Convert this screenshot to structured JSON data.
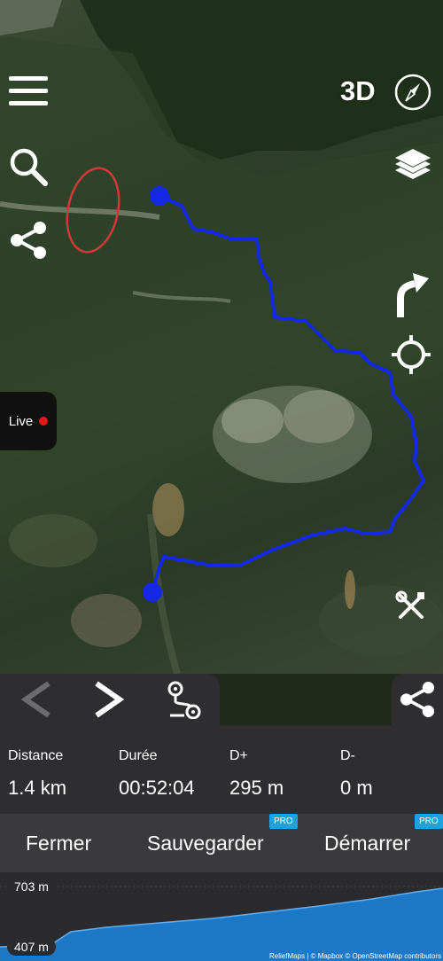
{
  "map": {
    "btn_3d": "3D",
    "live_label": "Live",
    "attribution": "ReliefMaps | © Mapbox © OpenStreetMap contributors",
    "track_color": "#1428e6",
    "live_dot_color": "#e01919",
    "annotation_color": "#d23a3a",
    "icons": [
      "menu-icon",
      "search-icon",
      "share-icon",
      "compass-icon",
      "layers-icon",
      "turn-arrow-icon",
      "locate-icon",
      "tools-icon"
    ]
  },
  "nav": {
    "prev_icon": "chevron-left-icon",
    "next_icon": "chevron-right-icon",
    "route_icon": "route-icon",
    "share_icon": "share-icon"
  },
  "stats": [
    {
      "label": "Distance",
      "value": "1.4 km"
    },
    {
      "label": "Durée",
      "value": "00:52:04"
    },
    {
      "label": "D+",
      "value": "295 m"
    },
    {
      "label": "D-",
      "value": "0 m"
    }
  ],
  "actions": {
    "close": "Fermer",
    "save": "Sauvegarder",
    "start": "Démarrer",
    "pro_badge": "PRO",
    "pro_badge_color": "#1aa3e0"
  },
  "profile": {
    "max_label": "703 m",
    "min_label": "407 m",
    "max_m": 703,
    "min_m": 407,
    "fill_color": "#1e78c8"
  }
}
